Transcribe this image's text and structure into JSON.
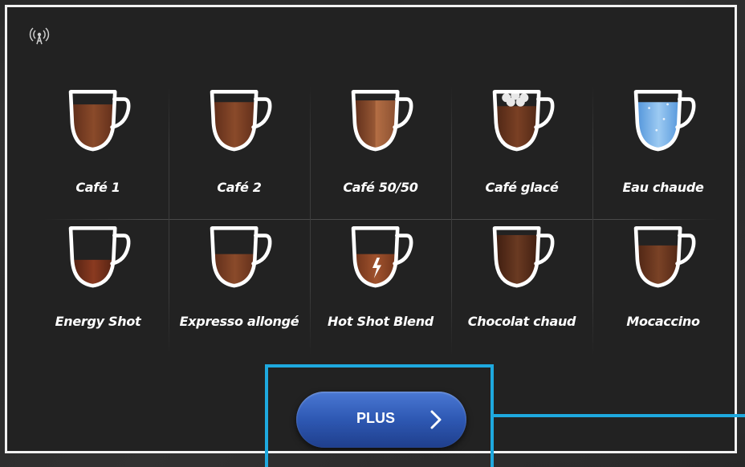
{
  "drinks": [
    {
      "label": "Café 1",
      "liquid": "#5a2a18",
      "liquid_light": "#8a4a2a",
      "fill": 0.78,
      "style": "coffee"
    },
    {
      "label": "Café 2",
      "liquid": "#5a2a18",
      "liquid_light": "#8a4a2a",
      "fill": 0.82,
      "style": "coffee"
    },
    {
      "label": "Café 50/50",
      "liquid": "#5a2a18",
      "liquid_light": "#9a5a36",
      "fill": 0.85,
      "style": "half"
    },
    {
      "label": "Café glacé",
      "liquid": "#4a2414",
      "liquid_light": "#7a4024",
      "fill": 0.75,
      "style": "iced"
    },
    {
      "label": "Eau chaude",
      "liquid": "#4a8fd8",
      "liquid_light": "#9ccaf2",
      "fill": 0.82,
      "style": "water"
    },
    {
      "label": "Energy Shot",
      "liquid": "#4a1e10",
      "liquid_light": "#8a3a20",
      "fill": 0.45,
      "style": "shot"
    },
    {
      "label": "Expresso allongé",
      "liquid": "#5a2a18",
      "liquid_light": "#8a4a2a",
      "fill": 0.55,
      "style": "coffee"
    },
    {
      "label": "Hot Shot Blend",
      "liquid": "#6a3018",
      "liquid_light": "#a0522d",
      "fill": 0.55,
      "style": "blend"
    },
    {
      "label": "Chocolat chaud",
      "liquid": "#3a1a0e",
      "liquid_light": "#6a3a22",
      "fill": 0.88,
      "style": "chocolate"
    },
    {
      "label": "Mocaccino",
      "liquid": "#4a2212",
      "liquid_light": "#7a4226",
      "fill": 0.7,
      "style": "coffee"
    }
  ],
  "more_button": {
    "label": "PLUS",
    "icon": "chevron-right-icon"
  },
  "status": {
    "icon": "wireless-signal-icon"
  },
  "colors": {
    "screen_bg": "#222222",
    "frame": "#f2f2f2",
    "button": "#2e58b3",
    "highlight": "#1ea9df",
    "cup_outline": "#ffffff"
  }
}
